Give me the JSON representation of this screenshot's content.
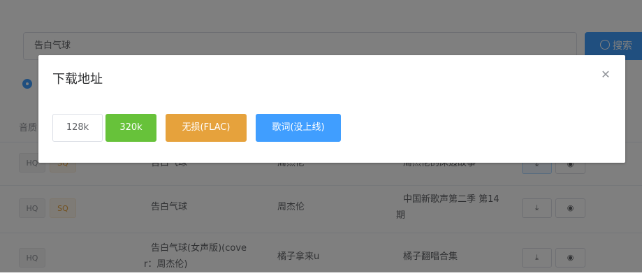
{
  "search": {
    "value": "告白气球",
    "button_label": "搜索"
  },
  "table": {
    "quality_header": "音质",
    "rows": [
      {
        "tags": [
          "HQ",
          "SQ"
        ],
        "title_line1": "告白气球",
        "title_line2": "",
        "artist": "周杰伦",
        "album_line1": "周杰伦的床边故事",
        "album_line2": ""
      },
      {
        "tags": [
          "HQ",
          "SQ"
        ],
        "title_line1": "告白气球",
        "title_line2": "",
        "artist": "周杰伦",
        "album_line1": "中国新歌声第二季 第14",
        "album_line2": "期"
      },
      {
        "tags": [
          "HQ"
        ],
        "title_line1": "告白气球(女声版)(cove",
        "title_line2": "r：周杰伦)",
        "artist": "橘子拿来u",
        "album_line1": "橘子翻唱合集",
        "album_line2": ""
      }
    ]
  },
  "dialog": {
    "title": "下载地址",
    "buttons": {
      "b128": "128k",
      "b320": "320k",
      "flac": "无损(FLAC)",
      "lyrics": "歌词(没上线)"
    }
  },
  "colors": {
    "primary": "#409eff",
    "success": "#67c23a",
    "warning": "#e6a23c",
    "overlay": "rgba(0,0,0,0.5)"
  }
}
